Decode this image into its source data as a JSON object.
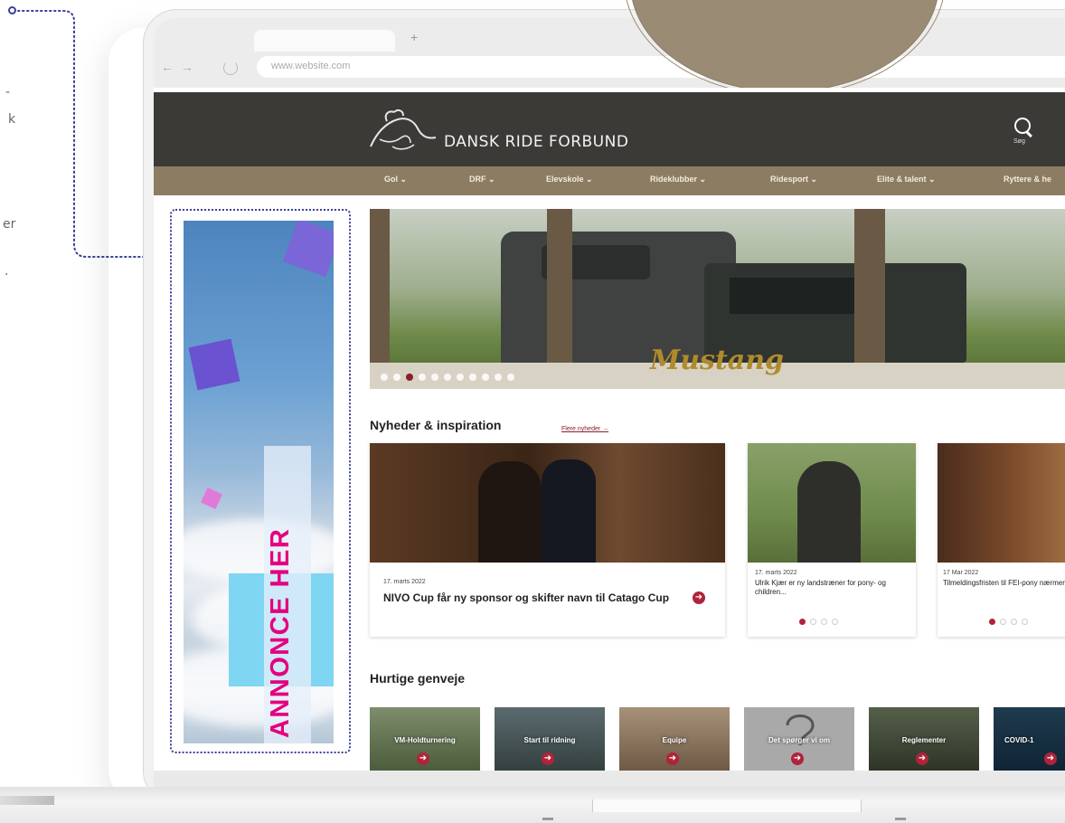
{
  "browser": {
    "tab_plus": "+",
    "nav_arrows": "← →",
    "url": "www.website.com"
  },
  "site": {
    "title": "DANSK RIDE FORBUND",
    "search_label": "Søg",
    "nav": [
      "Gol ⌄",
      "DRF ⌄",
      "Elevskole ⌄",
      "Rideklubber ⌄",
      "Ridesport ⌄",
      "Elite & talent ⌄",
      "Ryttere & he"
    ]
  },
  "ad": {
    "text": "DIN ANNONCE HER"
  },
  "annotation_fragments": [
    "-",
    "k",
    "er",
    "."
  ],
  "hero": {
    "brand_text": "Mustang",
    "dot_count": 11,
    "active_dot": 2
  },
  "news": {
    "title": "Nyheder & inspiration",
    "more_link": "Flere nyheder →",
    "cards": [
      {
        "date": "17. marts 2022",
        "title": "NIVO Cup får ny sponsor og skifter navn til Catago Cup"
      },
      {
        "date": "17. marts 2022",
        "title": "Ulrik Kjær er ny landstræner for pony- og children..."
      },
      {
        "date": "17 Mar 2022",
        "title": "Tilmeldingsfristen til FEI-pony nærmer sig"
      }
    ],
    "arrow": "➜"
  },
  "shortcuts": {
    "title": "Hurtige genveje",
    "items": [
      "VM-Holdturnering",
      "Start til ridning",
      "Equipe",
      "Det spørger vi om",
      "Reglementer",
      "COVID-1"
    ],
    "arrow": "➜"
  },
  "colors": {
    "header_bg": "#3b3a37",
    "nav_bg": "#8c7d62",
    "accent": "#b0233a",
    "ad_text": "#e4007f",
    "annotation": "#3a3f9a"
  }
}
